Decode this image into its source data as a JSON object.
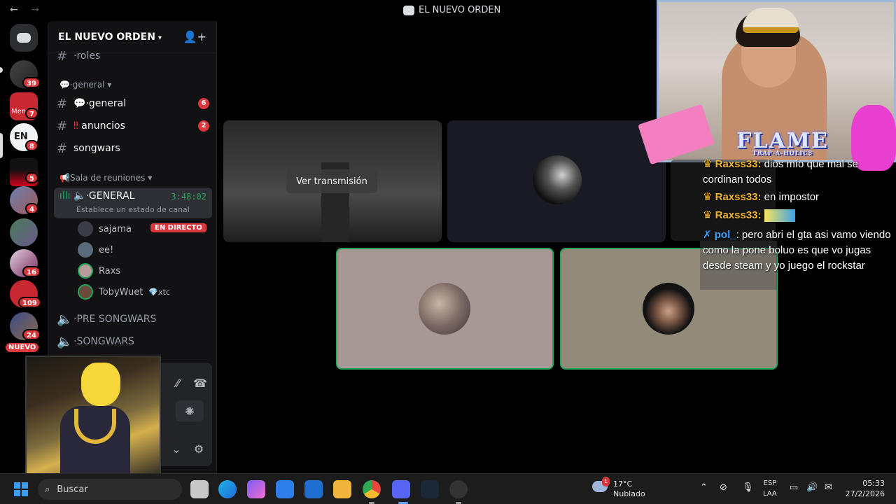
{
  "window": {
    "title": "EL NUEVO ORDEN",
    "back": "←",
    "forward": "→"
  },
  "rail": {
    "badges": [
      "39",
      "7",
      "8",
      "5",
      "4",
      "16",
      "109",
      "24"
    ],
    "new_label": "NUEVO",
    "server_labels": [
      "Men",
      "EN"
    ]
  },
  "guild": {
    "name": "EL NUEVO ORDEN",
    "channels": {
      "roles": "·roles",
      "general_category": "·general",
      "general": "·general",
      "general_count": "6",
      "anuncios": "anuncios",
      "anuncios_count": "2",
      "songwars": "songwars",
      "meeting_category": "Sala de reuniones",
      "voice_general": "·GENERAL",
      "voice_timer": "3:48:02",
      "voice_status": "Establece un estado de canal",
      "pre_songwars": "·PRE SONGWARS",
      "songwars_voice": "·SONGWARS"
    },
    "members": [
      {
        "name": "sajama"
      },
      {
        "name": "ee!"
      },
      {
        "name": "Raxs"
      },
      {
        "name": "TobyWuet",
        "tag": "xtc"
      }
    ],
    "live_label": "EN DIRECTO"
  },
  "stage": {
    "watch_button": "Ver transmisión"
  },
  "overlay": {
    "brand": "FLAME",
    "brand_sub": "TRAP-A-HOLICS",
    "chat": [
      {
        "user": "Raxss33:",
        "text": " dios mío que mal se cordinan todos"
      },
      {
        "user": "Raxss33:",
        "text": " en impostor"
      },
      {
        "user": "Raxss33:",
        "text": ""
      },
      {
        "user": "pol_",
        "text": ": pero abri el gta asi vamo viendo como la pone boluo es que vo jugas desde steam y yo juego el rockstar"
      }
    ]
  },
  "taskbar": {
    "search_placeholder": "Buscar",
    "weather_temp": "17°C",
    "weather_desc": "Nublado",
    "weather_badge": "1",
    "lang_top": "ESP",
    "lang_bottom": "LAA",
    "time": "05:33",
    "date": "27/2/2026"
  }
}
